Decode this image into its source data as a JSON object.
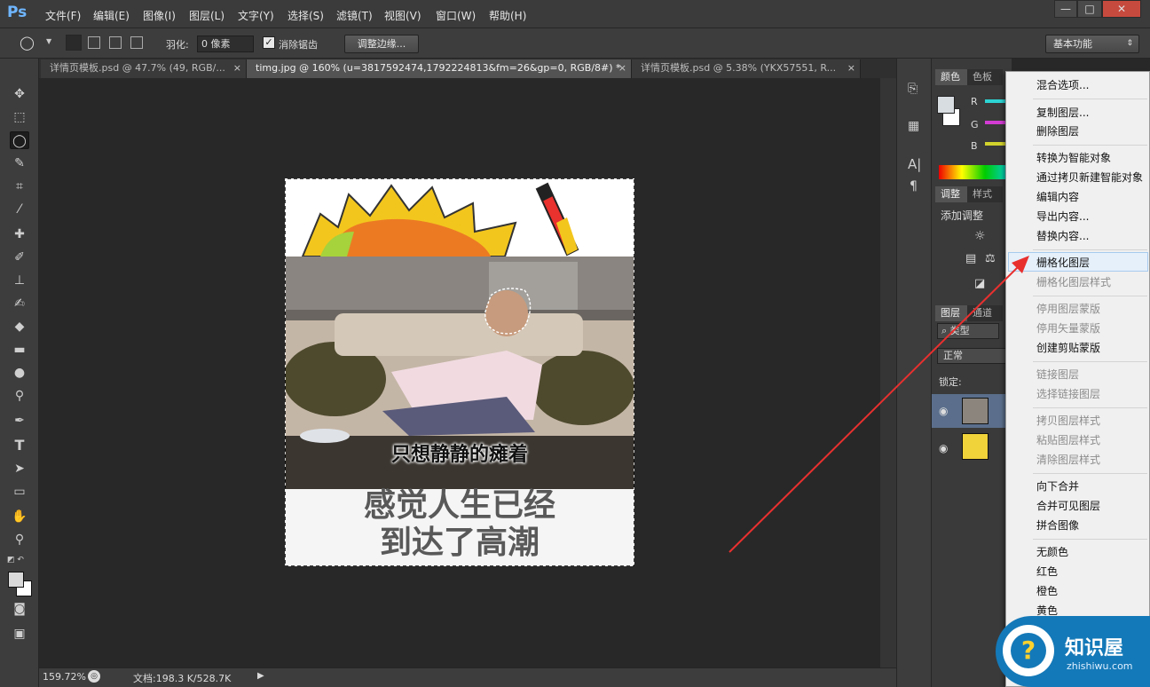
{
  "app": {
    "logo": "Ps",
    "menu": [
      "文件(F)",
      "编辑(E)",
      "图像(I)",
      "图层(L)",
      "文字(Y)",
      "选择(S)",
      "滤镜(T)",
      "视图(V)",
      "窗口(W)",
      "帮助(H)"
    ],
    "window_buttons": [
      "—",
      "□",
      "✕"
    ]
  },
  "options": {
    "feather_label": "羽化:",
    "feather_value": "0 像素",
    "antialias_label": "消除锯齿",
    "refine_edge": "调整边缘...",
    "workspace": "基本功能"
  },
  "tabs": [
    {
      "label": "详情页模板.psd @ 47.7% (49, RGB/...",
      "close": "×"
    },
    {
      "label": "timg.jpg @ 160% (u=3817592474,1792224813&fm=26&gp=0, RGB/8#) *",
      "close": "×"
    },
    {
      "label": "详情页模板.psd @ 5.38% (YKX57551, R...",
      "close": "×"
    }
  ],
  "canvas": {
    "meme_caption": "只想静静的瘫着",
    "meme_text_line1": "感觉人生已经",
    "meme_text_line2": "到达了高潮"
  },
  "status": {
    "zoom": "159.72%",
    "doc_size": "文档:198.3 K/528.7K"
  },
  "panels": {
    "color_tabs": [
      "颜色",
      "色板"
    ],
    "rgb_labels": [
      "R",
      "G",
      "B"
    ],
    "adjust_tabs": [
      "调整",
      "样式"
    ],
    "adjust_title": "添加调整",
    "layers_tabs": [
      "图层",
      "通道"
    ],
    "kind_filter": "类型",
    "blend_mode": "正常",
    "lock_label": "锁定:"
  },
  "context_menu": {
    "items": [
      {
        "label": "混合选项...",
        "disabled": false
      },
      {
        "label": "复制图层...",
        "disabled": false
      },
      {
        "label": "删除图层",
        "disabled": false
      },
      {
        "label": "转换为智能对象",
        "disabled": false
      },
      {
        "label": "通过拷贝新建智能对象",
        "disabled": false
      },
      {
        "label": "编辑内容",
        "disabled": false
      },
      {
        "label": "导出内容...",
        "disabled": false
      },
      {
        "label": "替换内容...",
        "disabled": false
      },
      {
        "label": "栅格化图层",
        "disabled": false,
        "highlighted": true
      },
      {
        "label": "栅格化图层样式",
        "disabled": true
      },
      {
        "label": "停用图层蒙版",
        "disabled": true
      },
      {
        "label": "停用矢量蒙版",
        "disabled": true
      },
      {
        "label": "创建剪贴蒙版",
        "disabled": false
      },
      {
        "label": "链接图层",
        "disabled": true
      },
      {
        "label": "选择链接图层",
        "disabled": true
      },
      {
        "label": "拷贝图层样式",
        "disabled": true
      },
      {
        "label": "粘贴图层样式",
        "disabled": true
      },
      {
        "label": "清除图层样式",
        "disabled": true
      },
      {
        "label": "向下合并",
        "disabled": false
      },
      {
        "label": "合并可见图层",
        "disabled": false
      },
      {
        "label": "拼合图像",
        "disabled": false
      },
      {
        "label": "无颜色",
        "disabled": false
      },
      {
        "label": "红色",
        "disabled": false
      },
      {
        "label": "橙色",
        "disabled": false
      },
      {
        "label": "黄色",
        "disabled": false
      },
      {
        "label": "绿色",
        "disabled": false
      }
    ]
  },
  "watermark": {
    "name": "知识屋",
    "url": "zhishiwu.com"
  },
  "colors": {
    "accent": "#1479b8",
    "arrow": "#e8302f",
    "ps_blue": "#6fb6ff"
  }
}
